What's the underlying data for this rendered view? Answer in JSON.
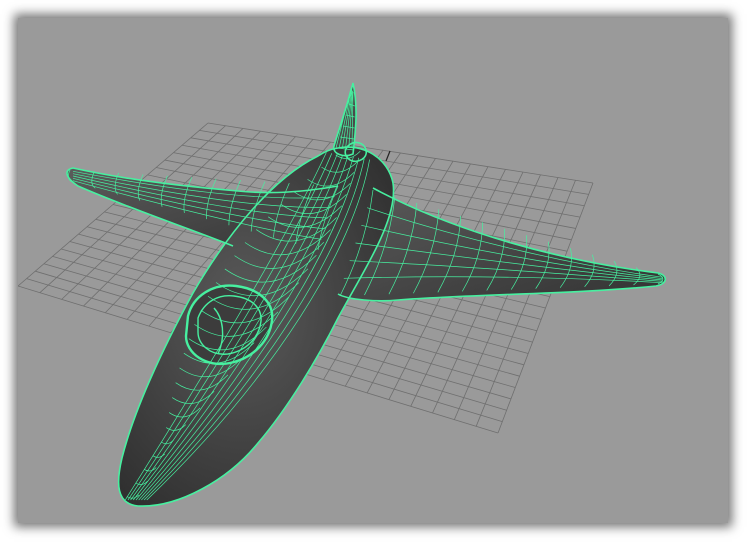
{
  "viewport": {
    "background": "#9a9a9a",
    "grid_color": "#6f6f6f",
    "wireframe_color": "#47f0a0",
    "surface_color": "#4b4b4b"
  },
  "model": {
    "type": "aircraft",
    "display_mode": "shaded-wireframe",
    "selected": true
  }
}
